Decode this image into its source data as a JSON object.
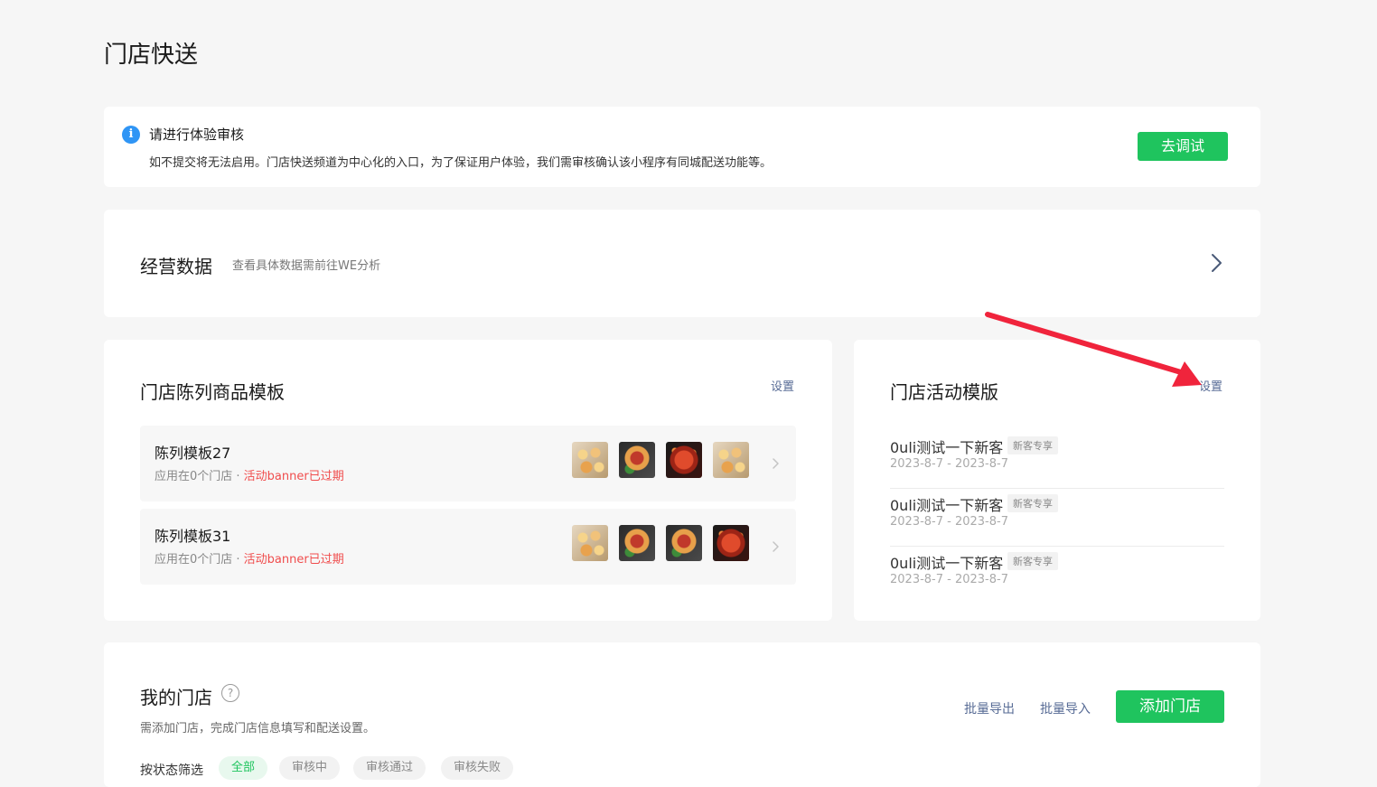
{
  "page": {
    "title": "门店快送"
  },
  "notice": {
    "title": "请进行体验审核",
    "desc": "如不提交将无法启用。门店快送频道为中心化的入口，为了保证用户体验，我们需审核确认该小程序有同城配送功能等。",
    "button": "去调试",
    "icon": "info-icon"
  },
  "business": {
    "title": "经营数据",
    "subtitle": "查看具体数据需前往WE分析",
    "icon": "chevron-right-icon"
  },
  "templates": {
    "title": "门店陈列商品模板",
    "set_label": "设置",
    "rows": [
      {
        "name": "陈列模板27",
        "meta": "应用在0个门店 · ",
        "status": "活动banner已过期"
      },
      {
        "name": "陈列模板31",
        "meta": "应用在0个门店 · ",
        "status": "活动banner已过期"
      }
    ]
  },
  "activities": {
    "title": "门店活动模版",
    "set_label": "设置",
    "items": [
      {
        "name": "0uli测试一下新客",
        "badge": "新客专享",
        "date": "2023-8-7 - 2023-8-7"
      },
      {
        "name": "0uli测试一下新客",
        "badge": "新客专享",
        "date": "2023-8-7 - 2023-8-7"
      },
      {
        "name": "0uli测试一下新客",
        "badge": "新客专享",
        "date": "2023-8-7 - 2023-8-7"
      }
    ]
  },
  "store": {
    "title": "我的门店",
    "help": "?",
    "desc": "需添加门店，完成门店信息填写和配送设置。",
    "export": "批量导出",
    "import": "批量导入",
    "add": "添加门店",
    "filter_label": "按状态筛选",
    "filters": [
      "全部",
      "审核中",
      "审核通过",
      "审核失败"
    ]
  },
  "colors": {
    "accent": "#1fc45e",
    "link": "#576b95",
    "danger": "#f04d4d",
    "arrow": "#f0243c"
  }
}
